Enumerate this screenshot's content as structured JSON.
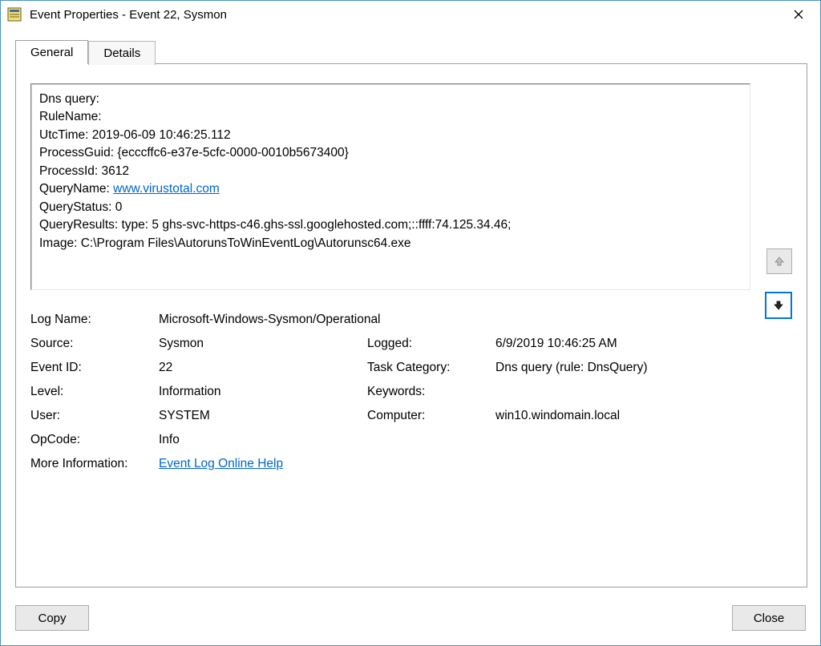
{
  "window": {
    "title": "Event Properties - Event 22, Sysmon"
  },
  "tabs": {
    "general": "General",
    "details": "Details"
  },
  "event_text": {
    "line1": "Dns query:",
    "line2": "RuleName:",
    "line3": "UtcTime: 2019-06-09 10:46:25.112",
    "line4": "ProcessGuid: {ecccffc6-e37e-5cfc-0000-0010b5673400}",
    "line5": "ProcessId: 3612",
    "line6a": "QueryName: ",
    "line6b": "www.virustotal.com",
    "line7": "QueryStatus: 0",
    "line8": "QueryResults: type:  5 ghs-svc-https-c46.ghs-ssl.googlehosted.com;::ffff:74.125.34.46;",
    "line9": "Image:  C:\\Program Files\\AutorunsToWinEventLog\\Autorunsc64.exe"
  },
  "details": {
    "log_name_label": "Log Name:",
    "log_name": "Microsoft-Windows-Sysmon/Operational",
    "source_label": "Source:",
    "source": "Sysmon",
    "logged_label": "Logged:",
    "logged": "6/9/2019 10:46:25 AM",
    "event_id_label": "Event ID:",
    "event_id": "22",
    "task_cat_label": "Task Category:",
    "task_cat": "Dns query (rule: DnsQuery)",
    "level_label": "Level:",
    "level": "Information",
    "keywords_label": "Keywords:",
    "keywords": "",
    "user_label": "User:",
    "user": "SYSTEM",
    "computer_label": "Computer:",
    "computer": "win10.windomain.local",
    "opcode_label": "OpCode:",
    "opcode": "Info",
    "more_info_label": "More Information:",
    "more_info_link": "Event Log Online Help"
  },
  "buttons": {
    "copy": "Copy",
    "close": "Close"
  }
}
